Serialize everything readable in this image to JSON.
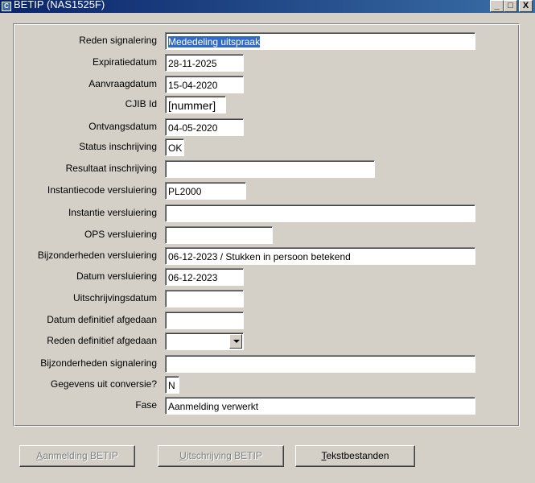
{
  "window": {
    "title": "BETIP (NAS1525F)",
    "icon_label": "C",
    "min_label": "_",
    "max_label": "□",
    "close_label": "X"
  },
  "form": {
    "reden_signalering": {
      "label": "Reden signalering",
      "value": "Mededeling uitspraak"
    },
    "expiratiedatum": {
      "label": "Expiratiedatum",
      "value": "28-11-2025"
    },
    "aanvraagdatum": {
      "label": "Aanvraagdatum",
      "value": "15-04-2020"
    },
    "cjib_id": {
      "label": "CJIB Id",
      "value": "[nummer]"
    },
    "ontvangsdatum": {
      "label": "Ontvangsdatum",
      "value": "04-05-2020"
    },
    "status_inschrijving": {
      "label": "Status inschrijving",
      "value": "OK"
    },
    "resultaat_inschrijving": {
      "label": "Resultaat inschrijving",
      "value": ""
    },
    "instantiecode_versluiering": {
      "label": "Instantiecode versluiering",
      "value": "PL2000"
    },
    "instantie_versluiering": {
      "label": "Instantie versluiering",
      "value": ""
    },
    "ops_versluiering": {
      "label": "OPS versluiering",
      "value": ""
    },
    "bijzonderheden_versluiering": {
      "label": "Bijzonderheden versluiering",
      "value": "06-12-2023 / Stukken in persoon betekend"
    },
    "datum_versluiering": {
      "label": "Datum versluiering",
      "value": "06-12-2023"
    },
    "uitschrijvingsdatum": {
      "label": "Uitschrijvingsdatum",
      "value": ""
    },
    "datum_definitief_afgedaan": {
      "label": "Datum definitief afgedaan",
      "value": ""
    },
    "reden_definitief_afgedaan": {
      "label": "Reden definitief afgedaan",
      "value": ""
    },
    "bijzonderheden_signalering": {
      "label": "Bijzonderheden signalering",
      "value": ""
    },
    "gegevens_uit_conversie": {
      "label": "Gegevens uit conversie?",
      "value": "N"
    },
    "fase": {
      "label": "Fase",
      "value": "Aanmelding verwerkt"
    }
  },
  "buttons": {
    "aanmelding": {
      "mnemonic": "A",
      "rest": "anmelding BETIP",
      "enabled": false
    },
    "uitschrijving": {
      "mnemonic": "U",
      "rest": "itschrijving BETIP",
      "enabled": false
    },
    "tekstbestanden": {
      "mnemonic": "T",
      "rest": "ekstbestanden",
      "enabled": true
    }
  }
}
